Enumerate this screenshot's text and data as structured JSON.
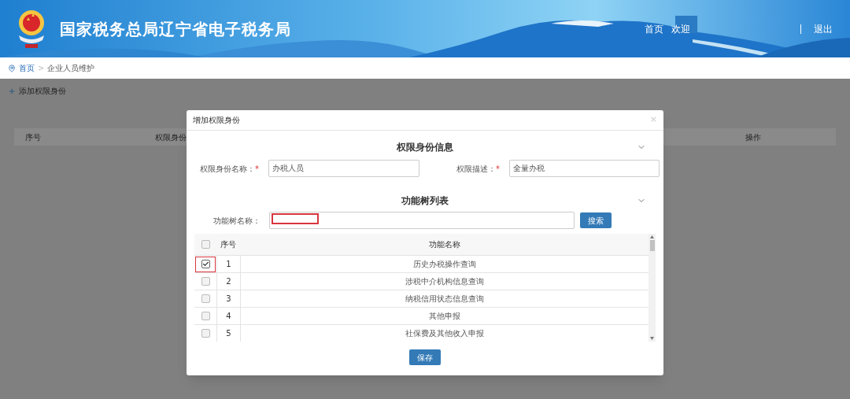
{
  "header": {
    "title": "国家税务总局辽宁省电子税务局",
    "nav": [
      "首页",
      "欢迎"
    ],
    "logout": "退出"
  },
  "breadcrumb": {
    "items": [
      "首页",
      "企业人员维护"
    ],
    "separator": ">"
  },
  "page": {
    "add_button": "添加权限身份",
    "columns": [
      "序号",
      "权限身份",
      "操作"
    ]
  },
  "dialog": {
    "title": "增加权限身份",
    "close": "×",
    "info_section": {
      "heading": "权限身份信息",
      "fields": [
        {
          "label": "权限身份名称：",
          "required_mark": "*",
          "value": "办税人员"
        },
        {
          "label": "权限描述：",
          "required_mark": "*",
          "value": "全量办税"
        }
      ]
    },
    "tree_section": {
      "heading": "功能树列表",
      "search": {
        "label": "功能树名称：",
        "highlighted": true
      },
      "search_button": "搜索"
    },
    "table": {
      "columns": [
        "序号",
        "功能名称"
      ],
      "all_checked": false,
      "rows": [
        {
          "no": "1",
          "name": "历史办税操作查询",
          "checked": true,
          "highlighted": true
        },
        {
          "no": "2",
          "name": "涉税中介机构信息查询",
          "checked": false,
          "highlighted": false
        },
        {
          "no": "3",
          "name": "纳税信用状态信息查询",
          "checked": false,
          "highlighted": false
        },
        {
          "no": "4",
          "name": "其他申报",
          "checked": false,
          "highlighted": false
        },
        {
          "no": "5",
          "name": "社保费及其他收入申报",
          "checked": false,
          "highlighted": false
        }
      ]
    },
    "save_button": "保存"
  }
}
